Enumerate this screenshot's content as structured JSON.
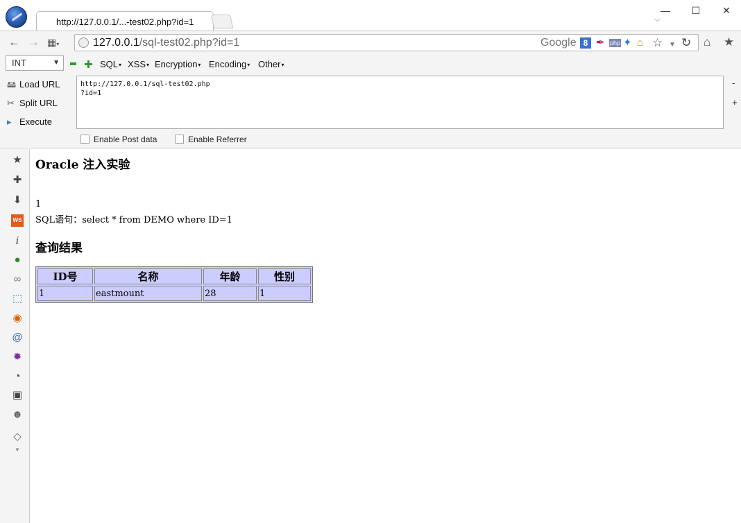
{
  "browser": {
    "tab_title": "http://127.0.0.1/...-test02.php?id=1",
    "window_controls": {
      "minimize": "—",
      "maximize": "☐",
      "close": "✕"
    },
    "url_host": "127.0.0.1",
    "url_path": "/sql-test02.php?id=1",
    "search_engine": "Google",
    "search_engine_badge": "8",
    "php_badge": "php"
  },
  "hackbar": {
    "type_select_value": "INT",
    "menus": [
      "SQL",
      "XSS",
      "Encryption",
      "Encoding",
      "Other"
    ],
    "actions": {
      "load_url": "Load URL",
      "split_url": "Split URL",
      "execute": "Execute"
    },
    "url_line1": "http://127.0.0.1/sql-test02.php",
    "url_line2": "?id=1",
    "minus_sign": "-",
    "plus_sign": "+",
    "enable_post": "Enable Post data",
    "enable_referrer": "Enable Referrer"
  },
  "page": {
    "title": "Oracle 注入实验",
    "id_value": "1",
    "sql_statement": "SQL语句：select * from DEMO where ID=1",
    "result_title": "查询结果",
    "table": {
      "headers": [
        "ID号",
        "名称",
        "年龄",
        "性别"
      ],
      "rows": [
        [
          "1",
          "eastmount",
          "28",
          "1"
        ]
      ]
    }
  },
  "colors": {
    "table_bg": "#ccccff",
    "chrome_bg": "#f4f4f4"
  }
}
